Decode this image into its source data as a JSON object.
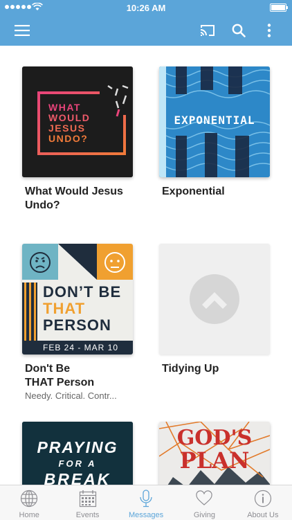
{
  "status": {
    "time": "10:26 AM"
  },
  "appbar": {
    "menu_icon": "hamburger-menu-icon",
    "cast_icon": "cast-icon",
    "search_icon": "search-icon",
    "more_icon": "more-vertical-icon"
  },
  "colors": {
    "accent": "#5ba5d9",
    "tab_inactive": "#8e8e93"
  },
  "messages": [
    {
      "title": "What Would Jesus Undo?",
      "art_text": [
        "WHAT",
        "WOULD",
        "JESUS",
        "UNDO?"
      ]
    },
    {
      "title": "Exponential",
      "art_text": "EXPONENTIAL"
    },
    {
      "title": "Don't Be THAT Person",
      "subtitle": "Needy. Critical. Contr...",
      "art_lines": [
        "DON’T BE",
        "THAT",
        "PERSON"
      ],
      "art_dates": "FEB 24 - MAR 10"
    },
    {
      "title": "Tidying Up",
      "placeholder_icon": "chevron-up-icon"
    },
    {
      "art_lines": [
        "PRAYING",
        "FOR A",
        "BREAK"
      ]
    },
    {
      "art_lines": [
        "GOD'S",
        "PLAN"
      ]
    }
  ],
  "tabs": [
    {
      "label": "Home",
      "icon": "globe-icon"
    },
    {
      "label": "Events",
      "icon": "calendar-icon"
    },
    {
      "label": "Messages",
      "icon": "microphone-icon",
      "active": true
    },
    {
      "label": "Giving",
      "icon": "heart-icon"
    },
    {
      "label": "About Us",
      "icon": "info-icon"
    }
  ]
}
